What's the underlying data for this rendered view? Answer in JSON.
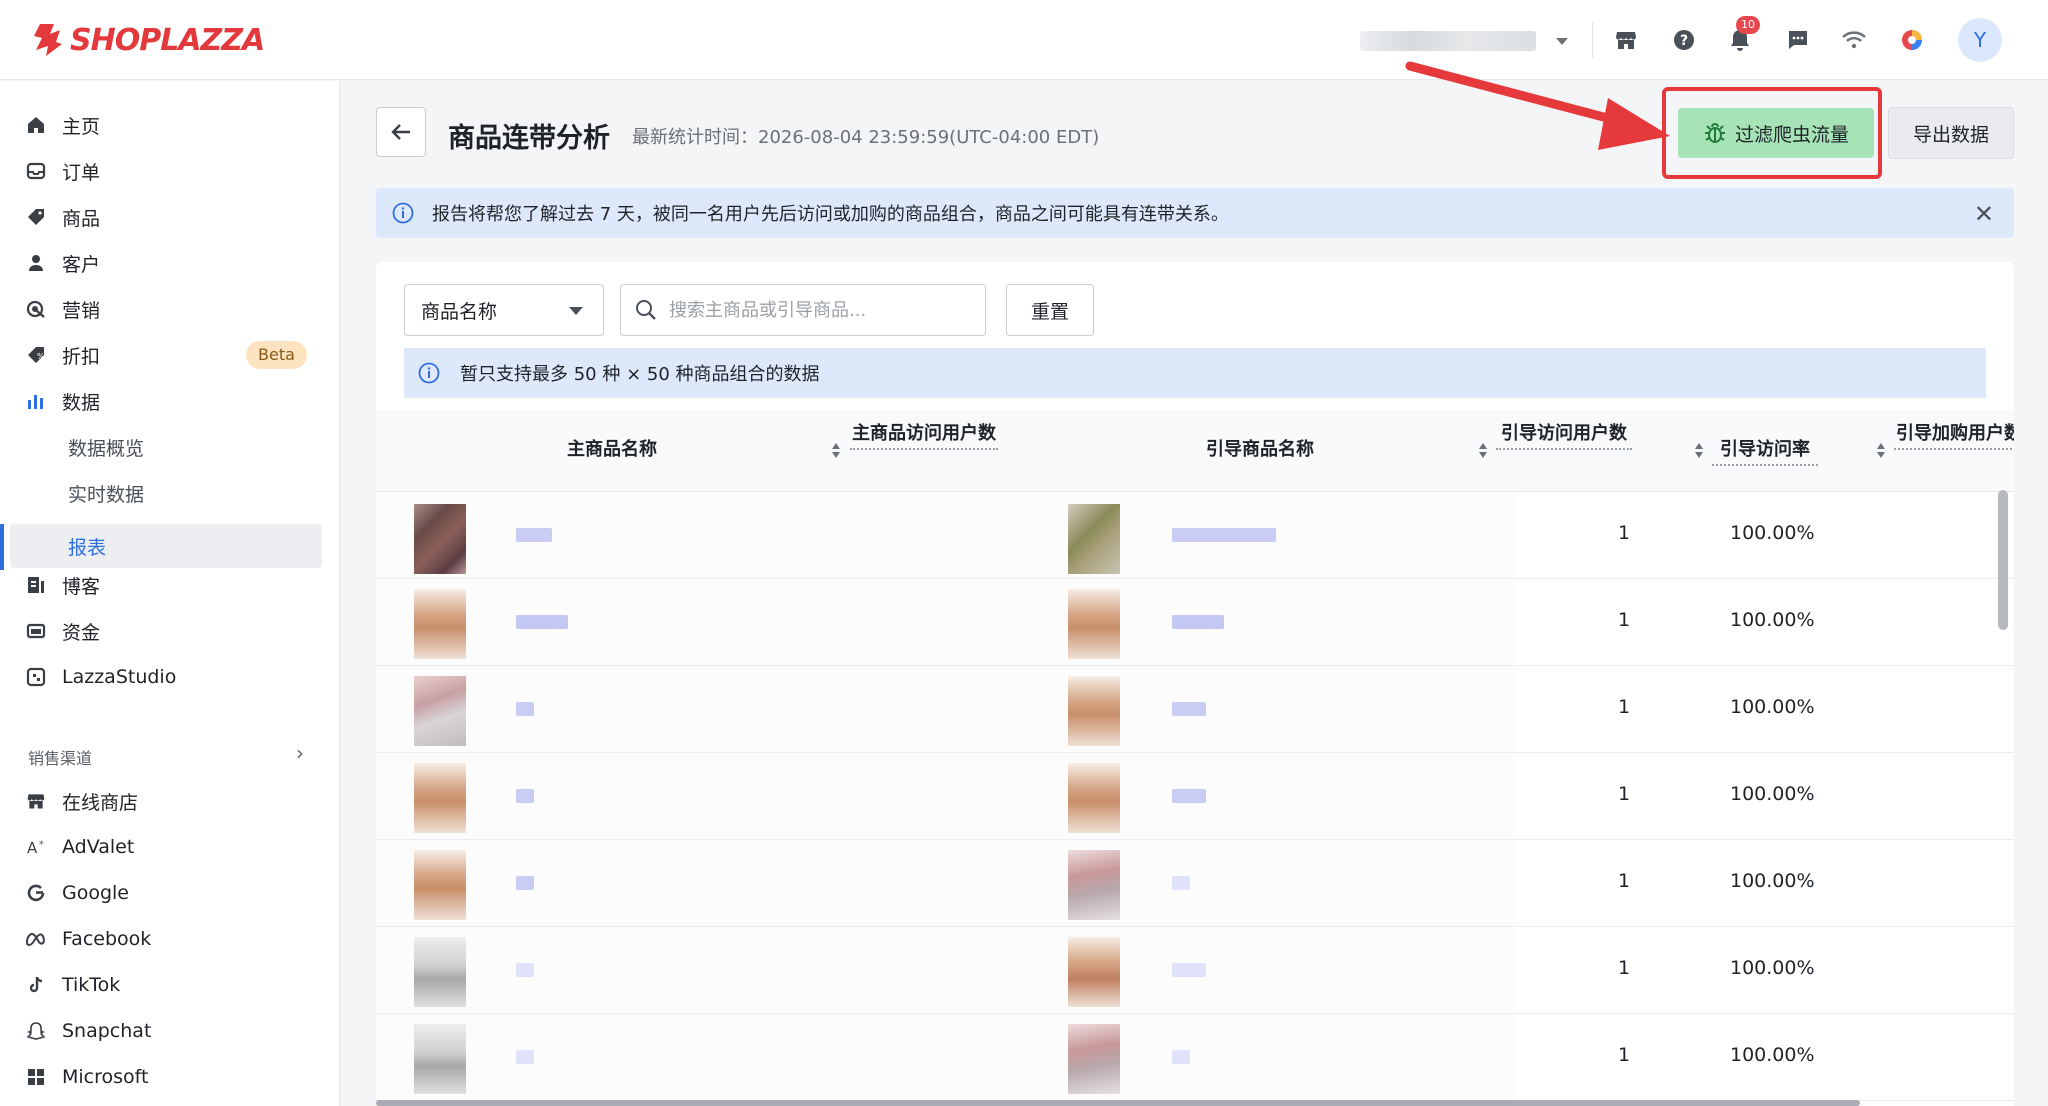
{
  "brand": {
    "name": "SHOPLAZZA",
    "color": "#e4393c"
  },
  "topbar": {
    "store_selector": "store-selector (blurred)",
    "notification_count": "10",
    "avatar_initial": "Y",
    "icons": [
      "store-icon",
      "help-icon",
      "bell-icon",
      "message-icon",
      "wifi-icon",
      "color-palette-icon"
    ]
  },
  "sidebar": {
    "items": [
      {
        "label": "主页",
        "icon": "home-icon"
      },
      {
        "label": "订单",
        "icon": "inbox-icon"
      },
      {
        "label": "商品",
        "icon": "tag-icon"
      },
      {
        "label": "客户",
        "icon": "user-icon"
      },
      {
        "label": "营销",
        "icon": "marketing-icon"
      },
      {
        "label": "折扣",
        "icon": "discount-icon",
        "badge": "Beta"
      },
      {
        "label": "数据",
        "icon": "bar-chart-icon"
      },
      {
        "label": "数据概览"
      },
      {
        "label": "实时数据"
      },
      {
        "label": "报表",
        "active": true
      },
      {
        "label": "博客",
        "icon": "blog-icon"
      },
      {
        "label": "资金",
        "icon": "wallet-icon"
      },
      {
        "label": "LazzaStudio",
        "icon": "studio-icon"
      }
    ],
    "sales_channels_title": "销售渠道",
    "channels": [
      {
        "label": "在线商店",
        "icon": "store-icon"
      },
      {
        "label": "AdValet",
        "icon": "advalet-icon"
      },
      {
        "label": "Google",
        "icon": "google-icon"
      },
      {
        "label": "Facebook",
        "icon": "meta-icon"
      },
      {
        "label": "TikTok",
        "icon": "tiktok-icon"
      },
      {
        "label": "Snapchat",
        "icon": "snapchat-icon"
      },
      {
        "label": "Microsoft",
        "icon": "microsoft-icon"
      }
    ]
  },
  "header": {
    "title": "商品连带分析",
    "meta": "最新统计时间：2026-08-04 23:59:59(UTC-04:00 EDT)",
    "filter_bot_button": "过滤爬虫流量",
    "export_button": "导出数据",
    "accent_green": "#a6e3b6",
    "annotation_red": "#e5393c"
  },
  "banner": {
    "text": "报告将帮您了解过去 7 天，被同一名用户先后访问或加购的商品组合，商品之间可能具有连带关系。"
  },
  "filters": {
    "select_value": "商品名称",
    "search_placeholder": "搜索主商品或引导商品...",
    "reset_button": "重置",
    "notice": "暂只支持最多 50 种 × 50 种商品组合的数据"
  },
  "table": {
    "columns": [
      "主商品名称",
      "主商品访问用户数",
      "引导商品名称",
      "引导访问用户数",
      "引导访问率",
      "引导加购用户数"
    ],
    "rows": [
      {
        "guided_visitors": "1",
        "guided_rate": "100.00%"
      },
      {
        "guided_visitors": "1",
        "guided_rate": "100.00%"
      },
      {
        "guided_visitors": "1",
        "guided_rate": "100.00%"
      },
      {
        "guided_visitors": "1",
        "guided_rate": "100.00%"
      },
      {
        "guided_visitors": "1",
        "guided_rate": "100.00%"
      },
      {
        "guided_visitors": "1",
        "guided_rate": "100.00%"
      },
      {
        "guided_visitors": "1",
        "guided_rate": "100.00%"
      }
    ]
  }
}
